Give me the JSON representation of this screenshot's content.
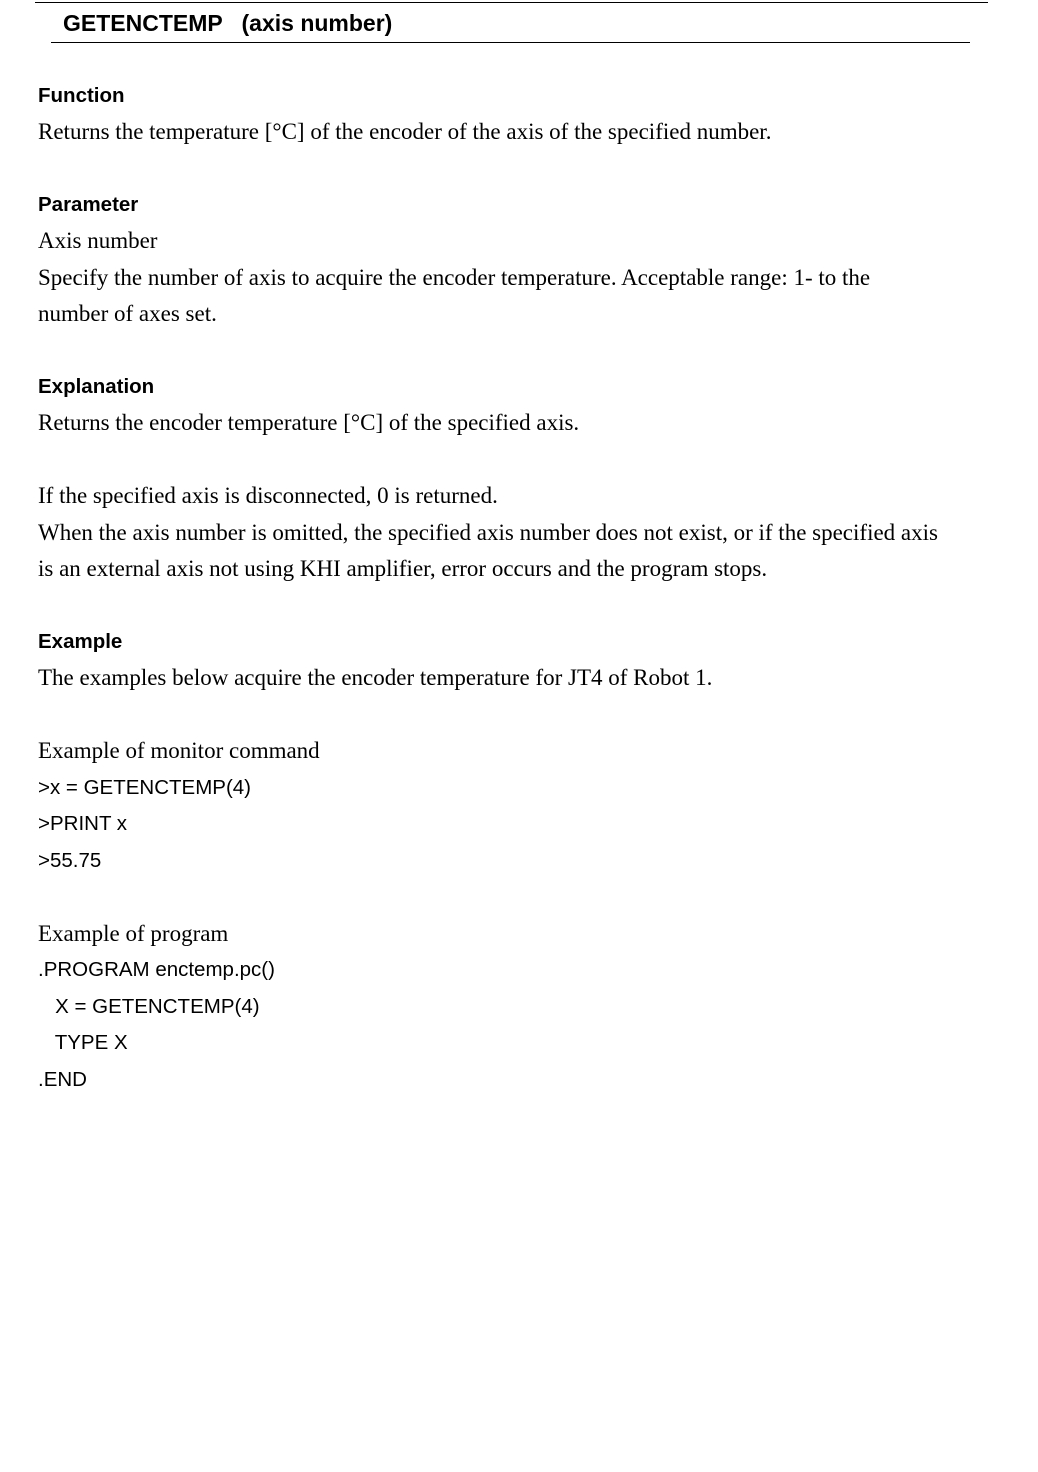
{
  "heading": {
    "command": "GETENCTEMP",
    "argument": "(axis number)"
  },
  "function": {
    "label": "Function",
    "text": "Returns the temperature [°C] of the encoder of the axis of the specified number."
  },
  "parameter": {
    "label": "Parameter",
    "name": "Axis number",
    "line1": "Specify the number of axis to acquire the encoder temperature. Acceptable range: 1- to the",
    "line2": "number of axes set."
  },
  "explanation": {
    "label": "Explanation",
    "text1": "Returns the encoder temperature [°C] of the specified axis.",
    "text2": "If the specified axis is disconnected, 0 is returned.",
    "text3_line1": "When the axis number is omitted, the specified axis number does not exist, or if the specified axis",
    "text3_line2": "is an external axis not using KHI amplifier, error occurs and the program stops."
  },
  "example": {
    "label": "Example",
    "intro": "The examples below acquire the encoder temperature for JT4 of Robot 1.",
    "monitor_title": "Example of monitor command",
    "monitor_lines": [
      ">x = GETENCTEMP(4)",
      ">PRINT x",
      ">55.75"
    ],
    "program_title": "Example of program",
    "program_lines": [
      ".PROGRAM enctemp.pc()",
      "   X = GETENCTEMP(4)",
      "   TYPE X",
      ".END"
    ]
  }
}
